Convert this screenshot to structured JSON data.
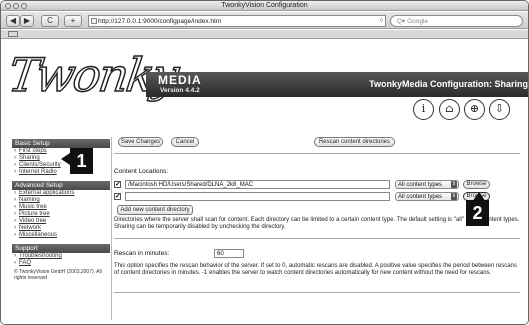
{
  "window": {
    "title": "TwonkyVision Configuration"
  },
  "toolbar": {
    "back_label": "◀",
    "forward_label": "▶",
    "reload_label": "C",
    "add_label": "+",
    "url": "http://127.0.0.1:9000/configpage/index.htm",
    "search_placeholder": "Q▾ Google"
  },
  "header": {
    "logo_text": "Twonky",
    "media_label": "MEDIA",
    "version": "Version 4.4.2",
    "title": "TwonkyMedia Configuration: Sharing",
    "icons": [
      "i",
      "⌂",
      "⊕",
      "⇩"
    ]
  },
  "sidebar": {
    "basic_setup": "Basic Setup",
    "basic_items": [
      "First steps",
      "Sharing",
      "Clients/Security",
      "Internet Radio"
    ],
    "advanced_setup": "Advanced Setup",
    "advanced_items": [
      "External applications",
      "Naming",
      "Music tree",
      "Picture tree",
      "Video tree",
      "Network",
      "Miscellaneous"
    ],
    "support": "Support",
    "support_items": [
      "Troubleshooting",
      "FAQ"
    ],
    "copyright": "© TwonkyVision GmbH (2003,2007). All rights reserved"
  },
  "content": {
    "save_label": "Save Changes",
    "cancel_label": "Cancel",
    "rescan_label": "Rescan content directories",
    "locations_label": "Content Locations:",
    "locations": [
      {
        "path": "/Macintosh HD/Users/Shared/DLNA_2k8_MAC",
        "type": "All content types",
        "browse": "Browse"
      },
      {
        "path": "",
        "type": "All content types",
        "browse": "Browse"
      }
    ],
    "add_dir_label": "Add new content directory",
    "dir_help": "Directories where the server shall scan for content. Each directory can be limited to a certain content type. The default setting is \"all\" for all content types. Sharing can be temporarily disabled by unchecking the directory.",
    "rescan_minutes_label": "Rescan in minutes:",
    "rescan_minutes_value": "60",
    "rescan_help": "This option specifies the rescan behavior of the server. If set to 0, automatic rescans are disabled. A positive value specifies the period between rescans of content directories in minutes. -1 enables the server to watch content directories automatically for new content without the need for rescans."
  },
  "callouts": {
    "one": "1",
    "two": "2"
  }
}
